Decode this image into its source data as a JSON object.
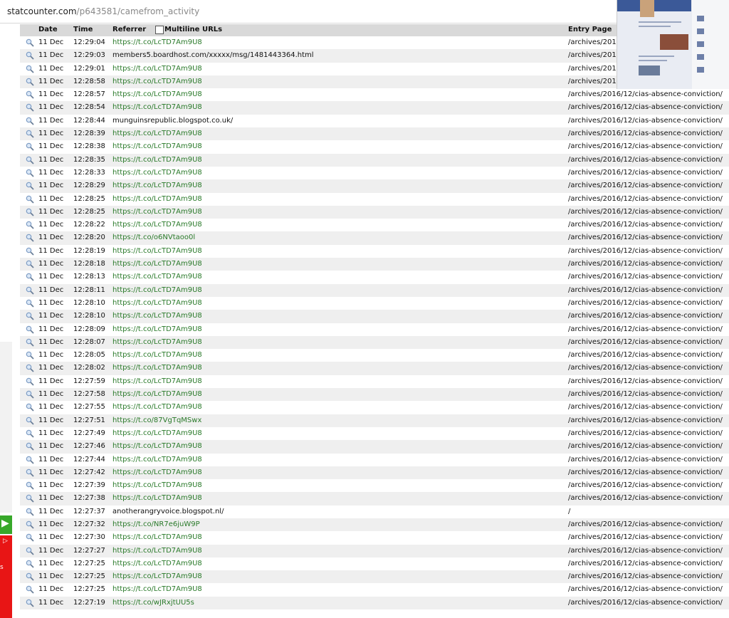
{
  "url_bar": {
    "domain": "statcounter.com",
    "path": "/p643581/camefrom_activity"
  },
  "left_widget": {
    "arrow_glyph": "▶",
    "ad_glyph": "▷",
    "ad_text": "s"
  },
  "table": {
    "headers": {
      "date": "Date",
      "time": "Time",
      "referrer": "Referrer",
      "multiline": "Multiline URLs",
      "entry": "Entry Page"
    },
    "rows": [
      {
        "date": "11 Dec",
        "time": "12:29:04",
        "referrer": "https://t.co/LcTD7Am9U8",
        "entry": "/archives/2016"
      },
      {
        "date": "11 Dec",
        "time": "12:29:03",
        "referrer": "members5.boardhost.com/xxxxx/msg/1481443364.html",
        "entry": "/archives/2016"
      },
      {
        "date": "11 Dec",
        "time": "12:29:01",
        "referrer": "https://t.co/LcTD7Am9U8",
        "entry": "/archives/2016"
      },
      {
        "date": "11 Dec",
        "time": "12:28:58",
        "referrer": "https://t.co/LcTD7Am9U8",
        "entry": "/archives/2016"
      },
      {
        "date": "11 Dec",
        "time": "12:28:57",
        "referrer": "https://t.co/LcTD7Am9U8",
        "entry": "/archives/2016/12/cias-absence-conviction/"
      },
      {
        "date": "11 Dec",
        "time": "12:28:54",
        "referrer": "https://t.co/LcTD7Am9U8",
        "entry": "/archives/2016/12/cias-absence-conviction/"
      },
      {
        "date": "11 Dec",
        "time": "12:28:44",
        "referrer": "munguinsrepublic.blogspot.co.uk/",
        "entry": "/archives/2016/12/cias-absence-conviction/"
      },
      {
        "date": "11 Dec",
        "time": "12:28:39",
        "referrer": "https://t.co/LcTD7Am9U8",
        "entry": "/archives/2016/12/cias-absence-conviction/"
      },
      {
        "date": "11 Dec",
        "time": "12:28:38",
        "referrer": "https://t.co/LcTD7Am9U8",
        "entry": "/archives/2016/12/cias-absence-conviction/"
      },
      {
        "date": "11 Dec",
        "time": "12:28:35",
        "referrer": "https://t.co/LcTD7Am9U8",
        "entry": "/archives/2016/12/cias-absence-conviction/"
      },
      {
        "date": "11 Dec",
        "time": "12:28:33",
        "referrer": "https://t.co/LcTD7Am9U8",
        "entry": "/archives/2016/12/cias-absence-conviction/"
      },
      {
        "date": "11 Dec",
        "time": "12:28:29",
        "referrer": "https://t.co/LcTD7Am9U8",
        "entry": "/archives/2016/12/cias-absence-conviction/"
      },
      {
        "date": "11 Dec",
        "time": "12:28:25",
        "referrer": "https://t.co/LcTD7Am9U8",
        "entry": "/archives/2016/12/cias-absence-conviction/"
      },
      {
        "date": "11 Dec",
        "time": "12:28:25",
        "referrer": "https://t.co/LcTD7Am9U8",
        "entry": "/archives/2016/12/cias-absence-conviction/"
      },
      {
        "date": "11 Dec",
        "time": "12:28:22",
        "referrer": "https://t.co/LcTD7Am9U8",
        "entry": "/archives/2016/12/cias-absence-conviction/"
      },
      {
        "date": "11 Dec",
        "time": "12:28:20",
        "referrer": "https://t.co/o6NVtaoo0l",
        "entry": "/archives/2016/12/cias-absence-conviction/"
      },
      {
        "date": "11 Dec",
        "time": "12:28:19",
        "referrer": "https://t.co/LcTD7Am9U8",
        "entry": "/archives/2016/12/cias-absence-conviction/"
      },
      {
        "date": "11 Dec",
        "time": "12:28:18",
        "referrer": "https://t.co/LcTD7Am9U8",
        "entry": "/archives/2016/12/cias-absence-conviction/"
      },
      {
        "date": "11 Dec",
        "time": "12:28:13",
        "referrer": "https://t.co/LcTD7Am9U8",
        "entry": "/archives/2016/12/cias-absence-conviction/"
      },
      {
        "date": "11 Dec",
        "time": "12:28:11",
        "referrer": "https://t.co/LcTD7Am9U8",
        "entry": "/archives/2016/12/cias-absence-conviction/"
      },
      {
        "date": "11 Dec",
        "time": "12:28:10",
        "referrer": "https://t.co/LcTD7Am9U8",
        "entry": "/archives/2016/12/cias-absence-conviction/"
      },
      {
        "date": "11 Dec",
        "time": "12:28:10",
        "referrer": "https://t.co/LcTD7Am9U8",
        "entry": "/archives/2016/12/cias-absence-conviction/"
      },
      {
        "date": "11 Dec",
        "time": "12:28:09",
        "referrer": "https://t.co/LcTD7Am9U8",
        "entry": "/archives/2016/12/cias-absence-conviction/"
      },
      {
        "date": "11 Dec",
        "time": "12:28:07",
        "referrer": "https://t.co/LcTD7Am9U8",
        "entry": "/archives/2016/12/cias-absence-conviction/"
      },
      {
        "date": "11 Dec",
        "time": "12:28:05",
        "referrer": "https://t.co/LcTD7Am9U8",
        "entry": "/archives/2016/12/cias-absence-conviction/"
      },
      {
        "date": "11 Dec",
        "time": "12:28:02",
        "referrer": "https://t.co/LcTD7Am9U8",
        "entry": "/archives/2016/12/cias-absence-conviction/"
      },
      {
        "date": "11 Dec",
        "time": "12:27:59",
        "referrer": "https://t.co/LcTD7Am9U8",
        "entry": "/archives/2016/12/cias-absence-conviction/"
      },
      {
        "date": "11 Dec",
        "time": "12:27:58",
        "referrer": "https://t.co/LcTD7Am9U8",
        "entry": "/archives/2016/12/cias-absence-conviction/"
      },
      {
        "date": "11 Dec",
        "time": "12:27:55",
        "referrer": "https://t.co/LcTD7Am9U8",
        "entry": "/archives/2016/12/cias-absence-conviction/"
      },
      {
        "date": "11 Dec",
        "time": "12:27:51",
        "referrer": "https://t.co/87VgTqMSwx",
        "entry": "/archives/2016/12/cias-absence-conviction/"
      },
      {
        "date": "11 Dec",
        "time": "12:27:49",
        "referrer": "https://t.co/LcTD7Am9U8",
        "entry": "/archives/2016/12/cias-absence-conviction/"
      },
      {
        "date": "11 Dec",
        "time": "12:27:46",
        "referrer": "https://t.co/LcTD7Am9U8",
        "entry": "/archives/2016/12/cias-absence-conviction/"
      },
      {
        "date": "11 Dec",
        "time": "12:27:44",
        "referrer": "https://t.co/LcTD7Am9U8",
        "entry": "/archives/2016/12/cias-absence-conviction/"
      },
      {
        "date": "11 Dec",
        "time": "12:27:42",
        "referrer": "https://t.co/LcTD7Am9U8",
        "entry": "/archives/2016/12/cias-absence-conviction/"
      },
      {
        "date": "11 Dec",
        "time": "12:27:39",
        "referrer": "https://t.co/LcTD7Am9U8",
        "entry": "/archives/2016/12/cias-absence-conviction/"
      },
      {
        "date": "11 Dec",
        "time": "12:27:38",
        "referrer": "https://t.co/LcTD7Am9U8",
        "entry": "/archives/2016/12/cias-absence-conviction/"
      },
      {
        "date": "11 Dec",
        "time": "12:27:37",
        "referrer": "anotherangryvoice.blogspot.nl/",
        "entry": "/"
      },
      {
        "date": "11 Dec",
        "time": "12:27:32",
        "referrer": "https://t.co/NR7e6juW9P",
        "entry": "/archives/2016/12/cias-absence-conviction/"
      },
      {
        "date": "11 Dec",
        "time": "12:27:30",
        "referrer": "https://t.co/LcTD7Am9U8",
        "entry": "/archives/2016/12/cias-absence-conviction/"
      },
      {
        "date": "11 Dec",
        "time": "12:27:27",
        "referrer": "https://t.co/LcTD7Am9U8",
        "entry": "/archives/2016/12/cias-absence-conviction/"
      },
      {
        "date": "11 Dec",
        "time": "12:27:25",
        "referrer": "https://t.co/LcTD7Am9U8",
        "entry": "/archives/2016/12/cias-absence-conviction/"
      },
      {
        "date": "11 Dec",
        "time": "12:27:25",
        "referrer": "https://t.co/LcTD7Am9U8",
        "entry": "/archives/2016/12/cias-absence-conviction/"
      },
      {
        "date": "11 Dec",
        "time": "12:27:25",
        "referrer": "https://t.co/LcTD7Am9U8",
        "entry": "/archives/2016/12/cias-absence-conviction/"
      },
      {
        "date": "11 Dec",
        "time": "12:27:19",
        "referrer": "https://t.co/wJRxjtUU5s",
        "entry": "/archives/2016/12/cias-absence-conviction/"
      }
    ]
  },
  "colors": {
    "link_green": "#2a7a2a",
    "header_gray": "#d9d9d9",
    "row_alt": "#efefef"
  }
}
